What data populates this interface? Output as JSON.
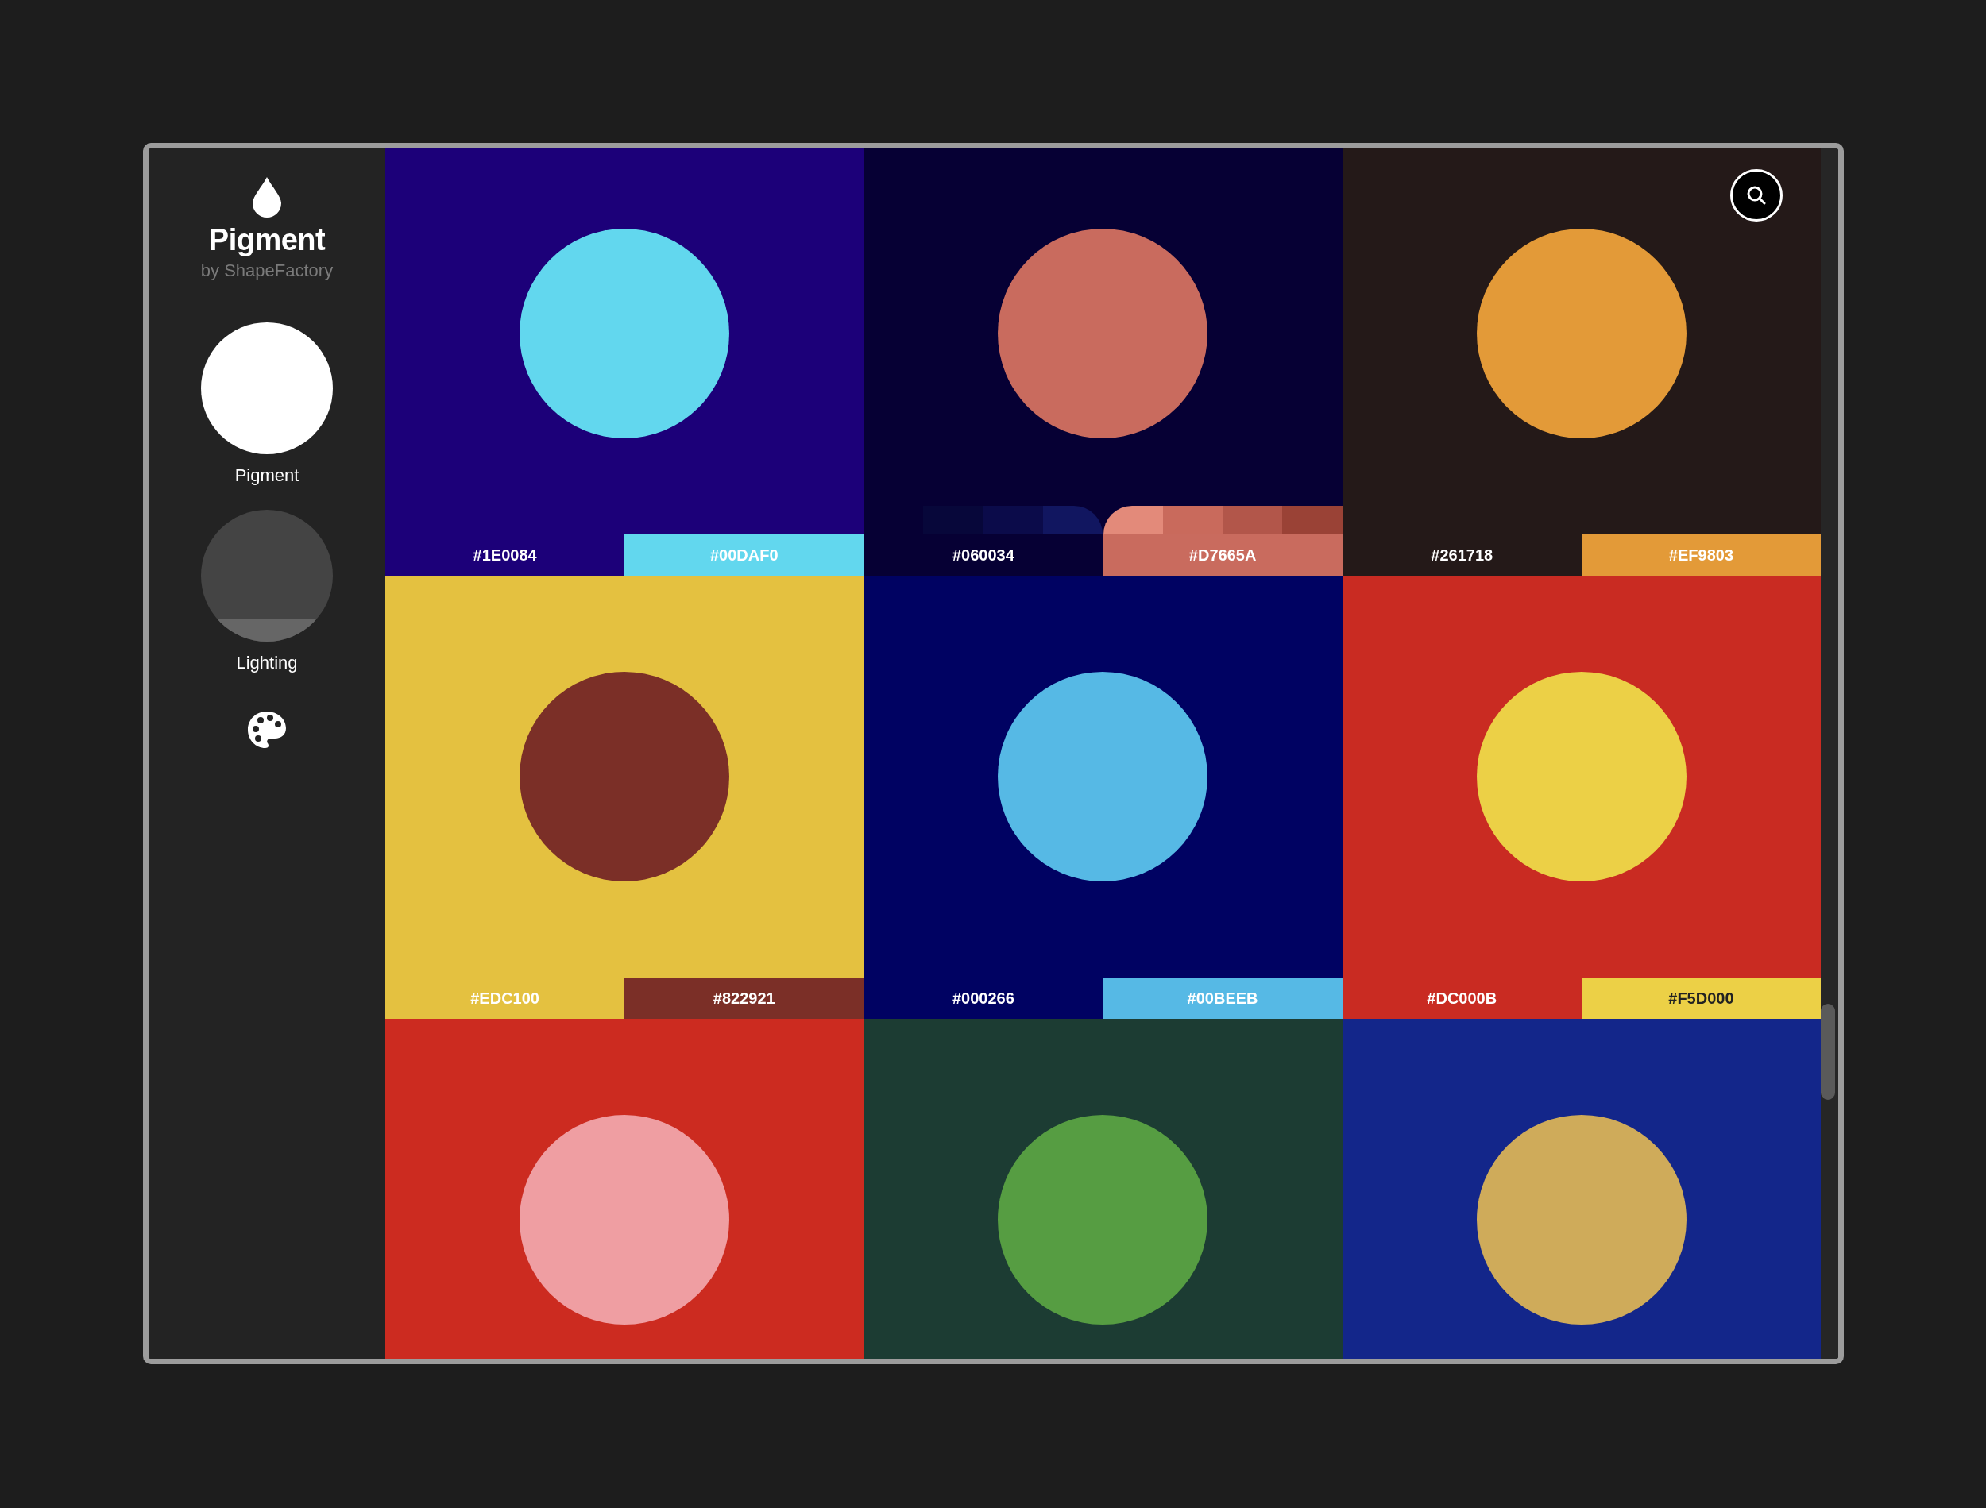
{
  "sidebar": {
    "app_name": "Pigment",
    "byline": "by ShapeFactory",
    "items": [
      {
        "kind": "pigment",
        "label": "Pigment",
        "selected": true
      },
      {
        "kind": "lighting",
        "label": "Lighting",
        "selected": false
      }
    ]
  },
  "tiles": [
    {
      "color": "#1c0079",
      "circle": {
        "color": "#62d7ee"
      },
      "swatches": [
        {
          "label": "#1E0084",
          "color": "#1c0079",
          "dark_text": false
        },
        {
          "label": "#00DAF0",
          "color": "#62d7ee",
          "dark_text": false
        }
      ]
    },
    {
      "color": "#060034",
      "circle": {
        "color": "#c96b5e"
      },
      "swatches": [
        {
          "label": "#060034",
          "color": "#060034",
          "dark_text": false,
          "shades": [
            {
              "color": "#07073a"
            },
            {
              "color": "#0b0b4a"
            },
            {
              "color": "#111660"
            }
          ]
        },
        {
          "label": "#D7665A",
          "color": "#c96b5e",
          "dark_text": false,
          "shades": [
            {
              "color": "#e38a7a"
            },
            {
              "color": "#c96a5c"
            },
            {
              "color": "#b2564a"
            },
            {
              "color": "#9a4236"
            }
          ]
        }
      ]
    },
    {
      "color": "#241918",
      "circle": {
        "color": "#e39a38"
      },
      "swatches": [
        {
          "label": "#261718",
          "color": "#241918",
          "dark_text": false
        },
        {
          "label": "#EF9803",
          "color": "#e39a38",
          "dark_text": false
        }
      ]
    },
    {
      "color": "#e4c140",
      "circle": {
        "color": "#7b2f27"
      },
      "swatches": [
        {
          "label": "#EDC100",
          "color": "#e4c140",
          "dark_text": false
        },
        {
          "label": "#822921",
          "color": "#7b2f27",
          "dark_text": false
        }
      ]
    },
    {
      "color": "#000262",
      "circle": {
        "color": "#56b9e5"
      },
      "swatches": [
        {
          "label": "#000266",
          "color": "#000262",
          "dark_text": false
        },
        {
          "label": "#00BEEB",
          "color": "#56b9e5",
          "dark_text": false
        }
      ]
    },
    {
      "color": "#c92b22",
      "circle": {
        "color": "#ecd046"
      },
      "swatches": [
        {
          "label": "#DC000B",
          "color": "#c92b22",
          "dark_text": false
        },
        {
          "label": "#F5D000",
          "color": "#ecd046",
          "dark_text": true
        }
      ]
    },
    {
      "color": "#cc2b20",
      "circle": {
        "color": "#ef9ea2"
      }
    },
    {
      "color": "#1c3c33",
      "circle": {
        "color": "#569d42"
      }
    },
    {
      "color": "#13268a",
      "circle": {
        "color": "#cfab5a"
      }
    }
  ]
}
